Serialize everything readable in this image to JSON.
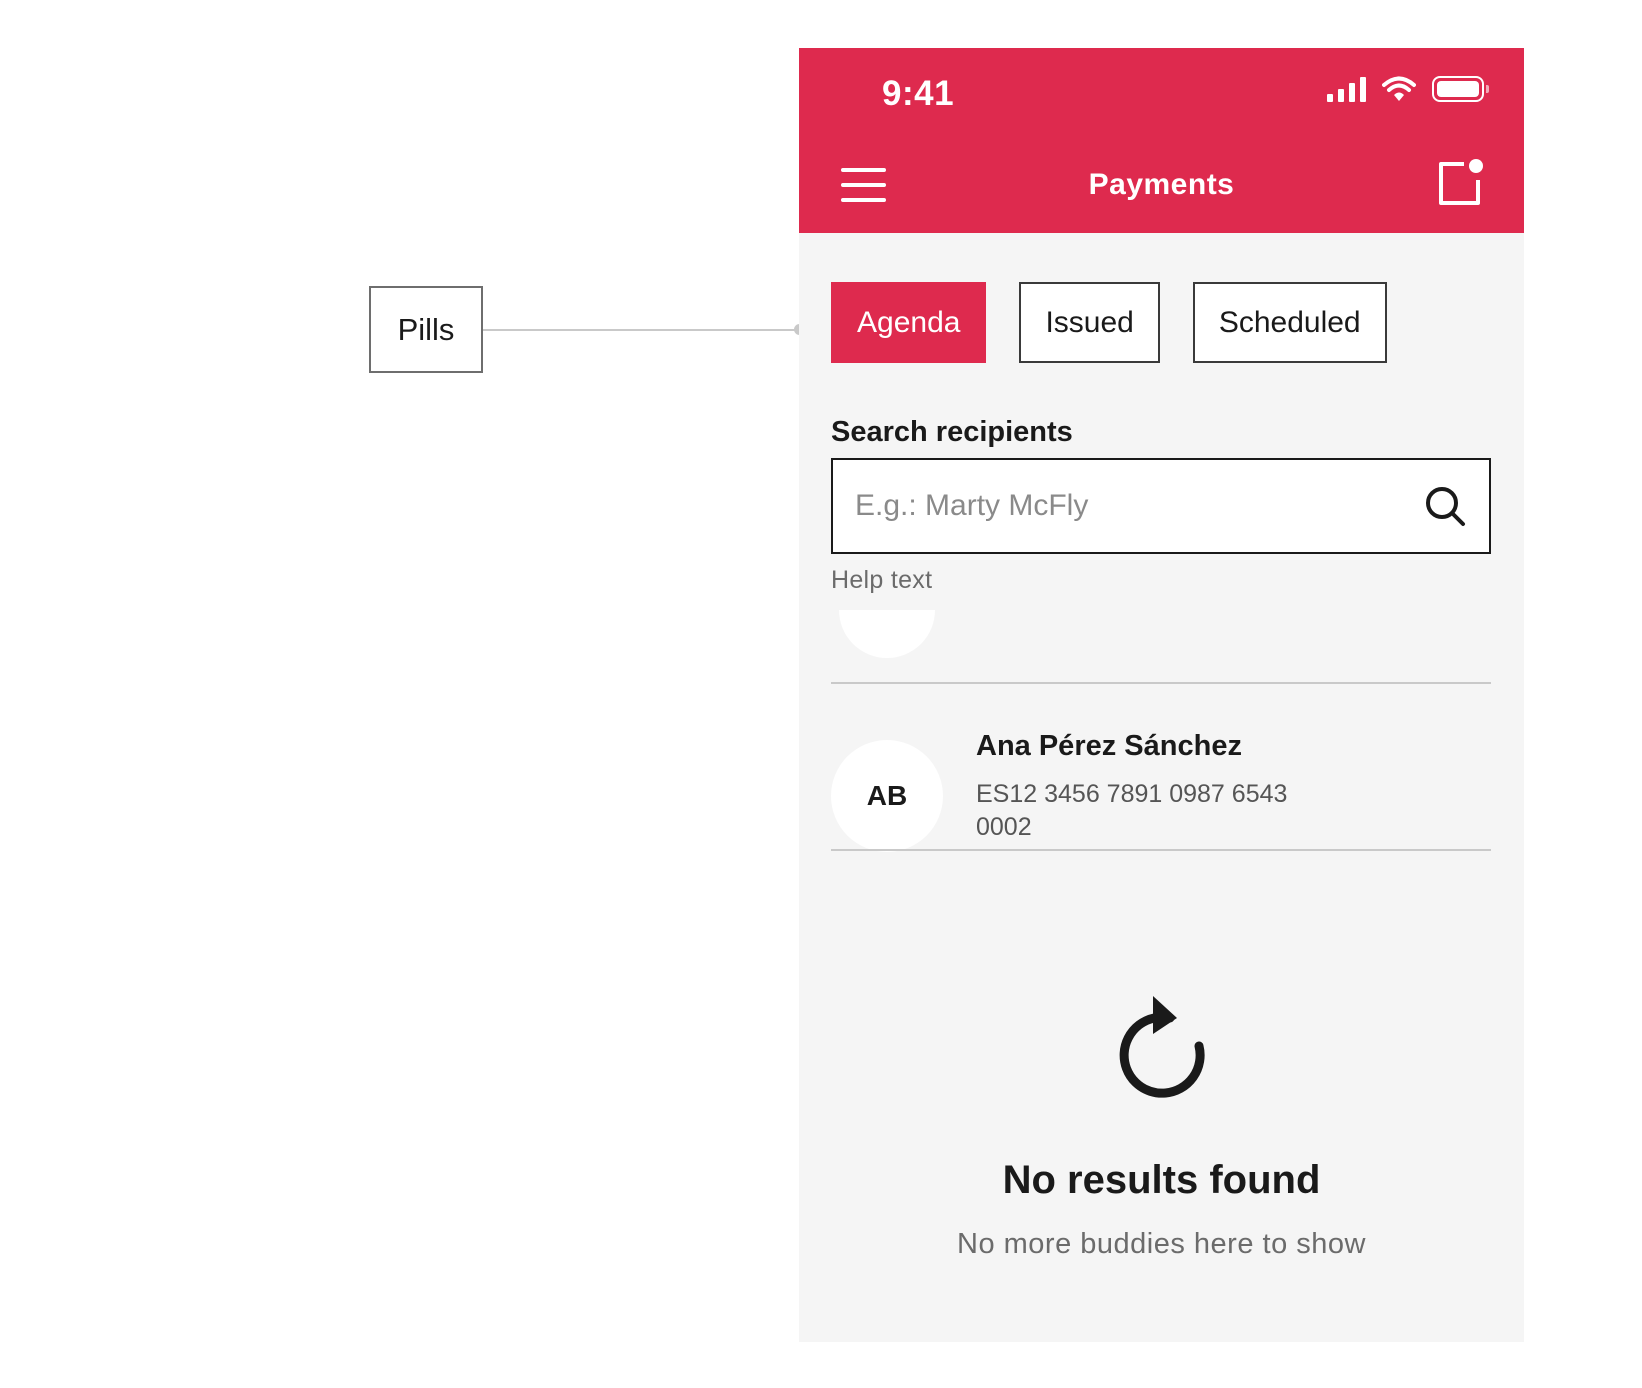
{
  "annotation": {
    "label": "Pills"
  },
  "status_bar": {
    "time": "9:41",
    "icons": [
      "signal-icon",
      "wifi-icon",
      "battery-icon"
    ]
  },
  "header": {
    "title": "Payments",
    "left_icon": "menu-icon",
    "right_icon": "notification-icon"
  },
  "pills": [
    {
      "label": "Agenda",
      "active": true
    },
    {
      "label": "Issued",
      "active": false
    },
    {
      "label": "Scheduled",
      "active": false
    }
  ],
  "search": {
    "label": "Search recipients",
    "placeholder": "E.g.: Marty McFly",
    "value": "",
    "help_text": "Help text"
  },
  "recipients": [
    {
      "initials": "AB",
      "name": "Ana Pérez Sánchez",
      "iban": "ES12 3456 7891 0987 6543 0002"
    }
  ],
  "empty_state": {
    "icon": "refresh-icon",
    "title": "No results found",
    "subtitle": "No more buddies here to show"
  },
  "colors": {
    "brand": "#de2a4e",
    "background": "#f5f5f5",
    "text": "#1a1a1a",
    "muted": "#6b6b6b"
  }
}
